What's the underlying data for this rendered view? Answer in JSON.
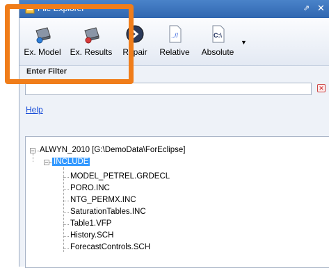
{
  "window": {
    "title": "File Explorer"
  },
  "toolbar": {
    "buttons": [
      {
        "label": "Ex. Model",
        "icon": "drive-export-icon"
      },
      {
        "label": "Ex. Results",
        "icon": "drive-results-icon"
      },
      {
        "label": "Repair",
        "icon": "repair-icon"
      },
      {
        "label": "Relative",
        "icon": "relative-path-icon"
      },
      {
        "label": "Absolute",
        "icon": "absolute-path-icon"
      }
    ],
    "absolute_icon_text": "C:\\",
    "relative_icon_text": "..//"
  },
  "filter": {
    "label": "Enter Filter",
    "value": "",
    "clear_symbol": "✕"
  },
  "help": {
    "label": "Help"
  },
  "tree": {
    "root": "ALWYN_2010 [G:\\DemoData\\ForEclipse]",
    "folder": "INCLUDE",
    "files": [
      "MODEL_PETREL.GRDECL",
      "PORO.INC",
      "NTG_PERMX.INC",
      "SaturationTables.INC",
      "Table1.VFP",
      "History.SCH",
      "ForecastControls.SCH"
    ],
    "collapse_symbol": "−"
  },
  "colors": {
    "highlight": "#f07d1a",
    "selection": "#3399ff",
    "titlebar": "#2f66b0"
  }
}
